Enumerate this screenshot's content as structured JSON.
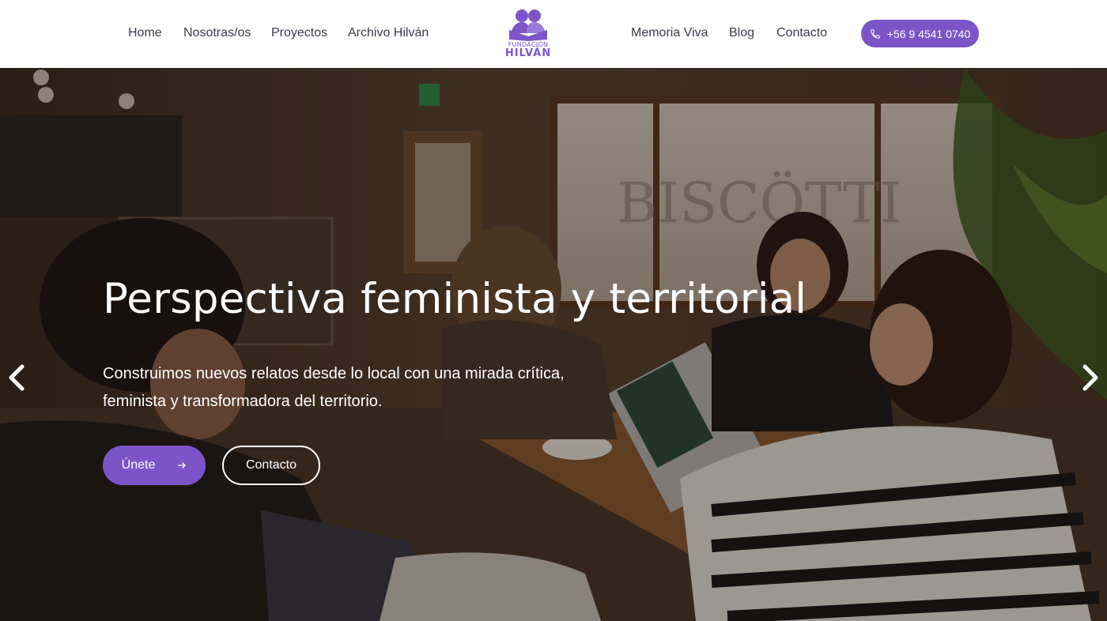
{
  "nav": {
    "left": [
      "Home",
      "Nosotras/os",
      "Proyectos",
      "Archivo Hilván"
    ],
    "right": [
      "Memoria Viva",
      "Blog",
      "Contacto"
    ]
  },
  "logo": {
    "line1": "FUNDACIÓN",
    "line2": "HILVÁN"
  },
  "phone": {
    "label": "+56 9 4541 0740",
    "icon": "phone-icon"
  },
  "hero": {
    "title": "Perspectiva feminista y territorial",
    "subtitle": "Construimos nuevos relatos desde lo local con una mirada crítica, feminista y transformadora del territorio.",
    "primary_button": "Únete",
    "secondary_button": "Contacto",
    "background_text": "BISCÖTTI"
  },
  "colors": {
    "accent": "#7b55c7",
    "header_bg": "#ffffff",
    "text": "#3b3b4a"
  }
}
